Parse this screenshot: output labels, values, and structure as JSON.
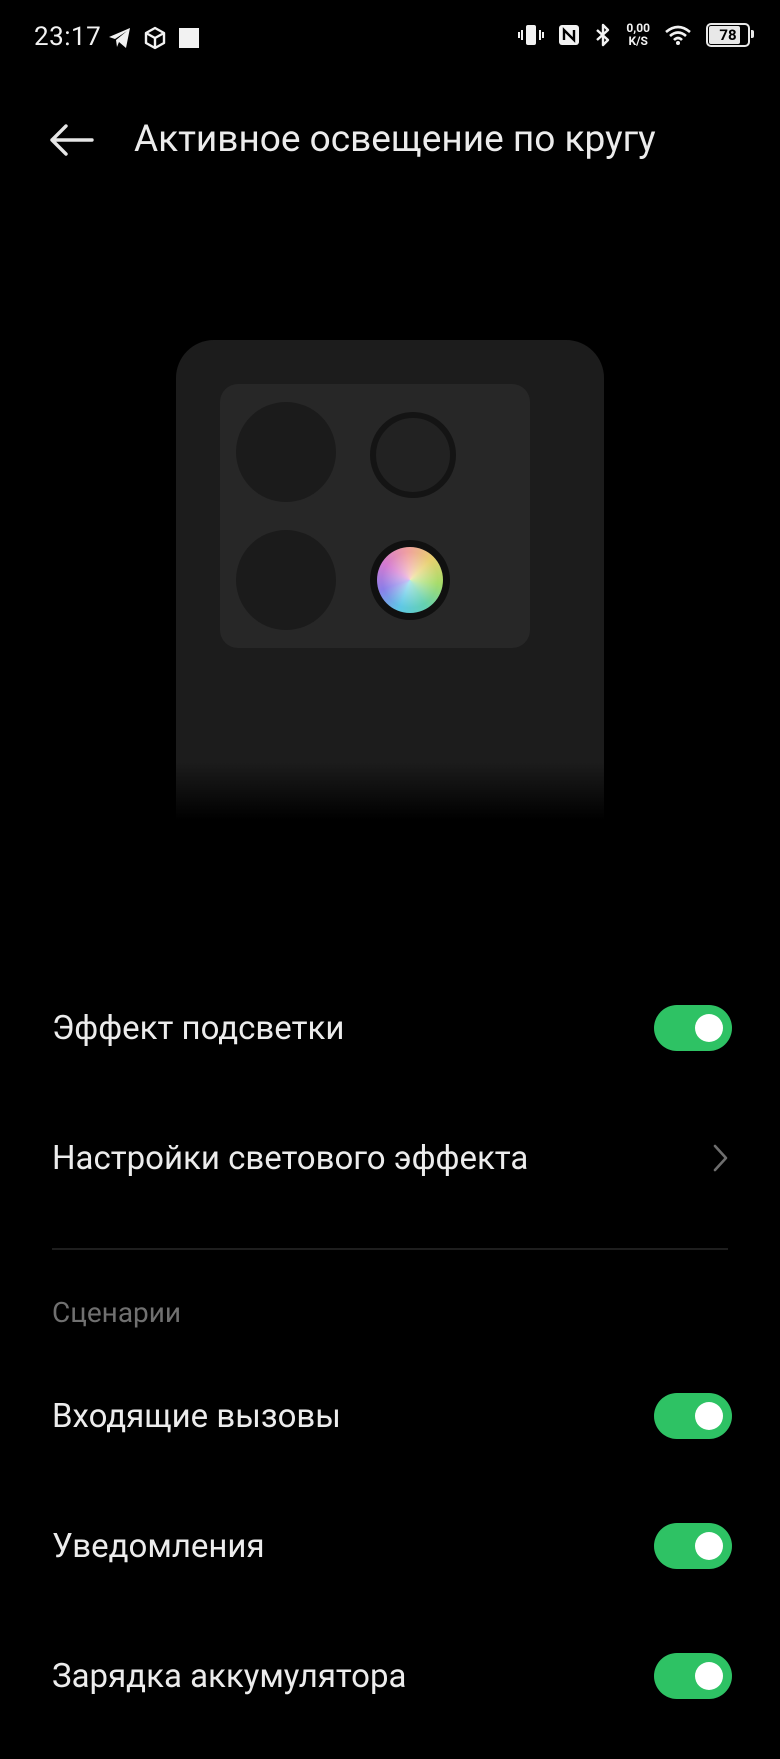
{
  "status_bar": {
    "time": "23:17",
    "net_speed_value": "0,00",
    "net_speed_unit": "K/S",
    "battery_level": "78",
    "left_icons": [
      "telegram-icon",
      "cube-icon",
      "square-icon"
    ],
    "right_icons": [
      "vibrate-icon",
      "nfc-icon",
      "bluetooth-icon",
      "wifi-icon"
    ]
  },
  "header": {
    "title": "Активное освещение по кругу",
    "back_icon": "back-arrow-icon"
  },
  "illustration": {
    "accent_colors": [
      "#5ec8e6",
      "#8a7ee8",
      "#d47ad0",
      "#f0a0a0",
      "#e8d070",
      "#a6dc6a"
    ]
  },
  "settings": {
    "lighting_effect": {
      "label": "Эффект подсветки",
      "enabled": true
    },
    "effect_settings": {
      "label": "Настройки светового эффекта",
      "icon": "chevron-right-icon"
    },
    "scenarios_header": "Сценарии",
    "incoming_calls": {
      "label": "Входящие вызовы",
      "enabled": true
    },
    "notifications": {
      "label": "Уведомления",
      "enabled": true
    },
    "battery_charging": {
      "label": "Зарядка аккумулятора",
      "enabled": true
    }
  },
  "colors": {
    "background": "#000000",
    "toggle_on": "#2ec264",
    "text_primary": "#ececec",
    "text_secondary": "#707070"
  }
}
